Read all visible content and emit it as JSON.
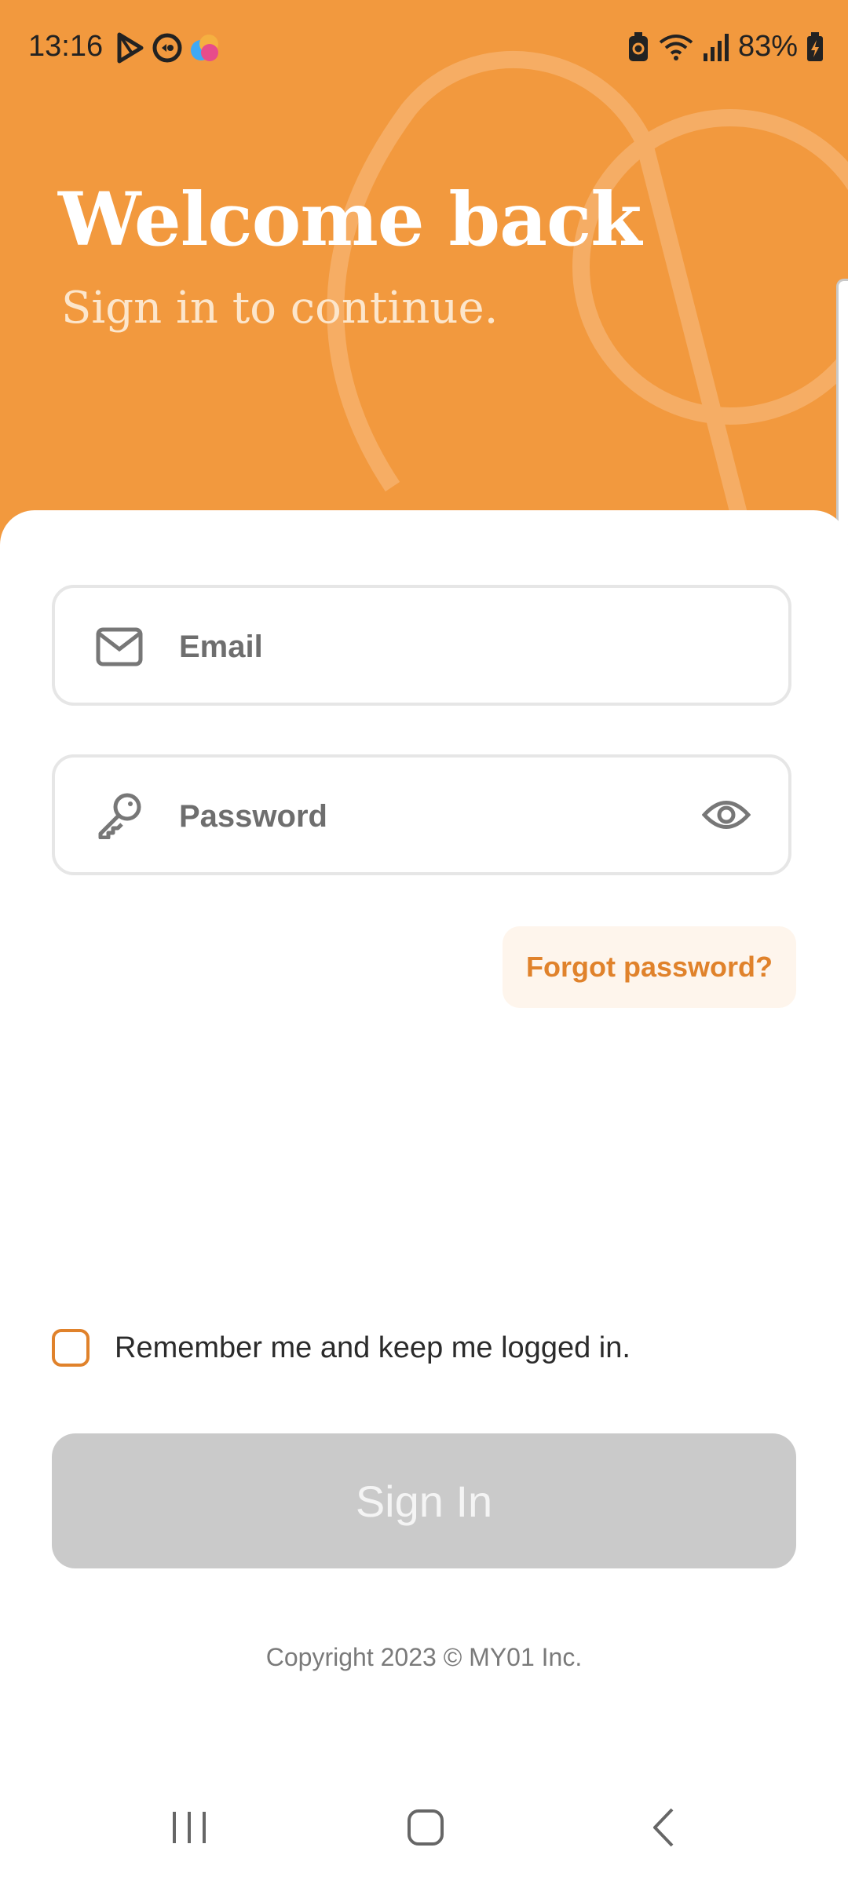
{
  "status_bar": {
    "time": "13:16",
    "battery_percent": "83%",
    "left_icons": [
      "play-store-icon",
      "activity-icon",
      "colorful-app-icon"
    ],
    "right_icons": [
      "battery-saver-icon",
      "wifi-icon",
      "signal-icon",
      "battery-charging-icon"
    ]
  },
  "hero": {
    "title": "Welcome back",
    "subtitle": "Sign in to continue.",
    "background_color": "#F2993E"
  },
  "form": {
    "email_placeholder": "Email",
    "email_icon": "mail-icon",
    "password_placeholder": "Password",
    "password_icon": "key-icon",
    "password_visibility_icon": "eye-icon",
    "forgot_password_label": "Forgot password?",
    "remember_label": "Remember me and keep me logged in.",
    "remember_checked": false,
    "signin_label": "Sign In"
  },
  "footer": {
    "copyright": "Copyright 2023 © MY01 Inc."
  },
  "nav_bar": {
    "buttons": [
      "recent-apps-icon",
      "home-icon",
      "back-icon"
    ]
  },
  "colors": {
    "accent": "#E0822B",
    "button_disabled": "#CACACA"
  }
}
